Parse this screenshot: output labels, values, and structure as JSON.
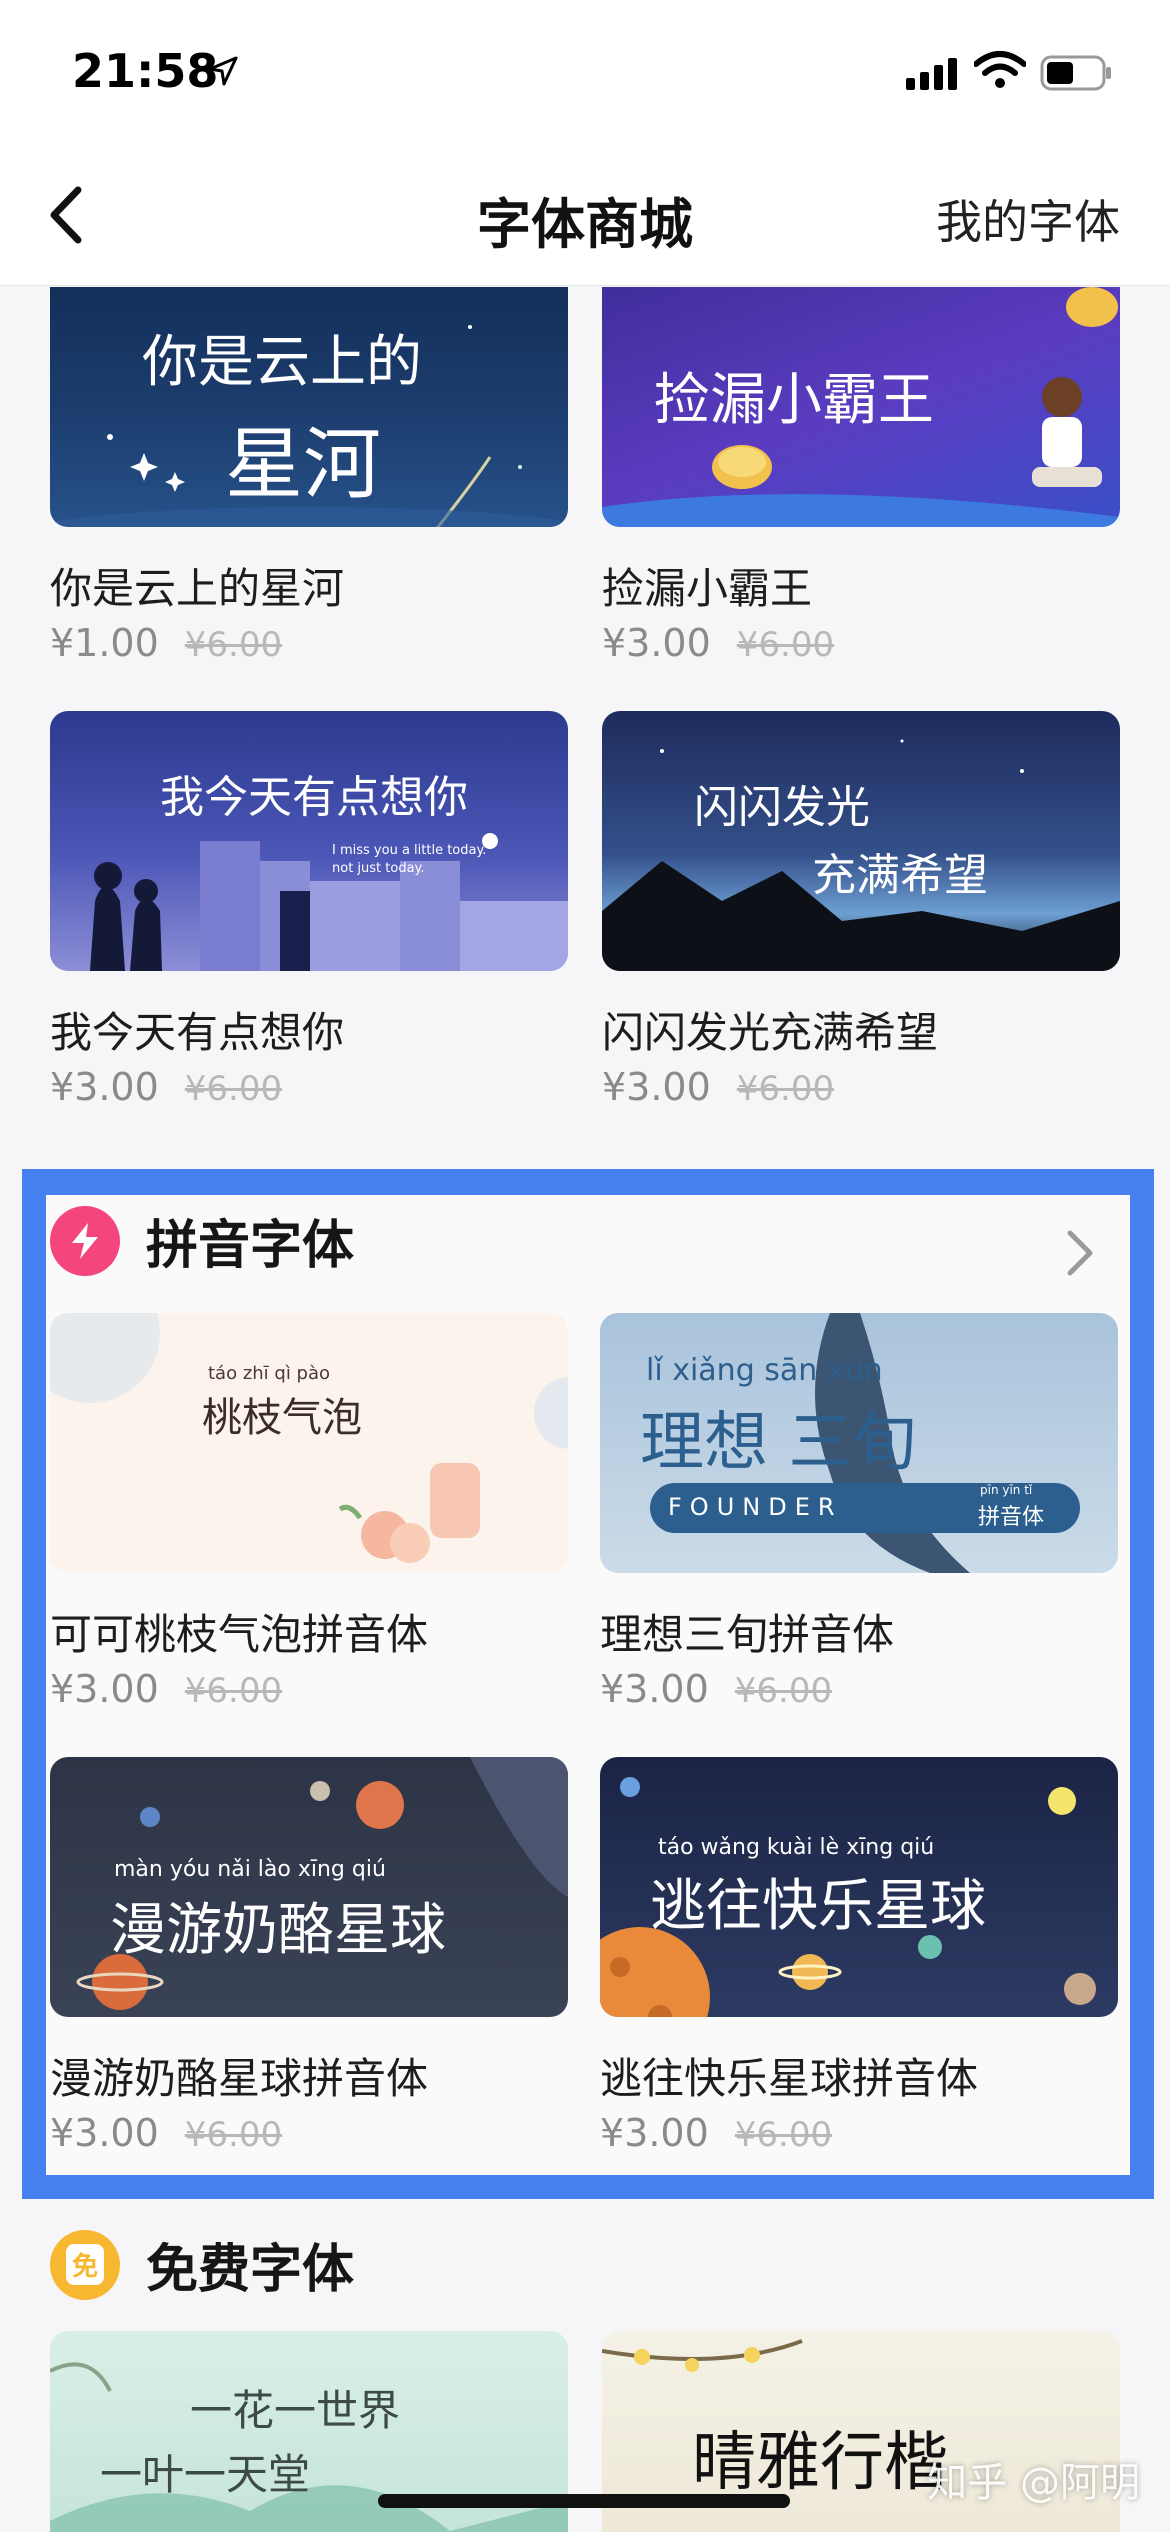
{
  "status_bar": {
    "time": "21:58"
  },
  "nav": {
    "title": "字体商城",
    "right_link": "我的字体",
    "back_icon": "chevron-left-icon"
  },
  "top_cards": [
    {
      "name": "你是云上的星河",
      "price": "¥1.00",
      "old_price": "¥6.00",
      "thumb_text": [
        "你是云上的",
        "星河"
      ]
    },
    {
      "name": "捡漏小霸王",
      "price": "¥3.00",
      "old_price": "¥6.00",
      "thumb_text": [
        "捡漏小霸王"
      ]
    },
    {
      "name": "我今天有点想你",
      "price": "¥3.00",
      "old_price": "¥6.00",
      "thumb_text": [
        "我今天有点想你",
        "I miss you a little today.",
        "not just today."
      ]
    },
    {
      "name": "闪闪发光充满希望",
      "price": "¥3.00",
      "old_price": "¥6.00",
      "thumb_text": [
        "闪闪发光",
        "充满希望"
      ]
    }
  ],
  "pinyin_section": {
    "title": "拼音字体",
    "icon": "lightning-icon",
    "cards": [
      {
        "name": "可可桃枝气泡拼音体",
        "price": "¥3.00",
        "old_price": "¥6.00",
        "thumb_pinyin": "táo zhī qì pào",
        "thumb_text": "桃枝气泡"
      },
      {
        "name": "理想三旬拼音体",
        "price": "¥3.00",
        "old_price": "¥6.00",
        "thumb_pinyin": "lǐ xiǎng sān xún",
        "thumb_text": "理想 三旬",
        "thumb_sub": "FOUNDER",
        "thumb_badge_pinyin": "pīn yīn tǐ",
        "thumb_badge": "拼音体"
      },
      {
        "name": "漫游奶酪星球拼音体",
        "price": "¥3.00",
        "old_price": "¥6.00",
        "thumb_pinyin": "màn yóu nǎi lào xīng qiú",
        "thumb_text": "漫游奶酪星球"
      },
      {
        "name": "逃往快乐星球拼音体",
        "price": "¥3.00",
        "old_price": "¥6.00",
        "thumb_pinyin": "táo wǎng kuài lè xīng qiú",
        "thumb_text": "逃往快乐星球"
      }
    ]
  },
  "free_section": {
    "title": "免费字体",
    "icon_text": "免",
    "cards": [
      {
        "thumb_text": [
          "一花一世界",
          "一叶一天堂"
        ]
      },
      {
        "thumb_text": [
          "晴雅行楷"
        ]
      }
    ]
  },
  "watermark": "知乎 @阿明",
  "colors": {
    "accent_frame": "#4780f1",
    "pinyin_icon": "#f4467c",
    "free_icon": "#f7b731"
  }
}
